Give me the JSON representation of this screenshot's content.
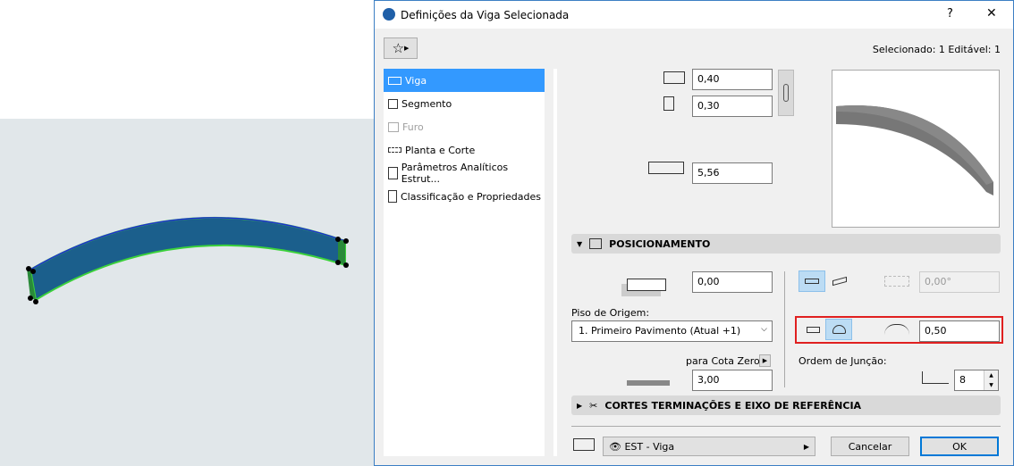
{
  "dialog": {
    "title": "Definições da Viga Selecionada",
    "help": "?",
    "close": "✕",
    "selection_info": "Selecionado: 1 Editável: 1"
  },
  "sidebar": {
    "items": [
      {
        "label": "Viga",
        "icon": "beam-icon",
        "selected": true
      },
      {
        "label": "Segmento",
        "icon": "segment-icon"
      },
      {
        "label": "Furo",
        "icon": "hole-icon",
        "disabled": true
      },
      {
        "label": "Planta e Corte",
        "icon": "floor-plan-icon"
      },
      {
        "label": "Parâmetros Analíticos Estrut...",
        "icon": "structural-analysis-icon"
      },
      {
        "label": "Classificação e Propriedades",
        "icon": "properties-icon"
      }
    ]
  },
  "geometry": {
    "height": "0,40",
    "width": "0,30",
    "length": "5,56"
  },
  "positioning": {
    "title": "POSICIONAMENTO",
    "offset": "0,00",
    "home_story_label": "Piso de Origem:",
    "home_story_value": "1. Primeiro Pavimento (Atual +1)",
    "ref_label": "para Cota Zero",
    "ref_value": "3,00",
    "tilt_angle": "0,00°",
    "arch_height": "0,50",
    "junction_label": "Ordem de Junção:",
    "junction_value": "8"
  },
  "cuts": {
    "title": "CORTES TERMINAÇÕES E EIXO DE REFERÊNCIA"
  },
  "footer": {
    "layer": "EST - Viga",
    "cancel": "Cancelar",
    "ok": "OK"
  },
  "colors": {
    "accent": "#3399ff",
    "highlight": "#e02020",
    "beam": "#1b5f8c"
  }
}
